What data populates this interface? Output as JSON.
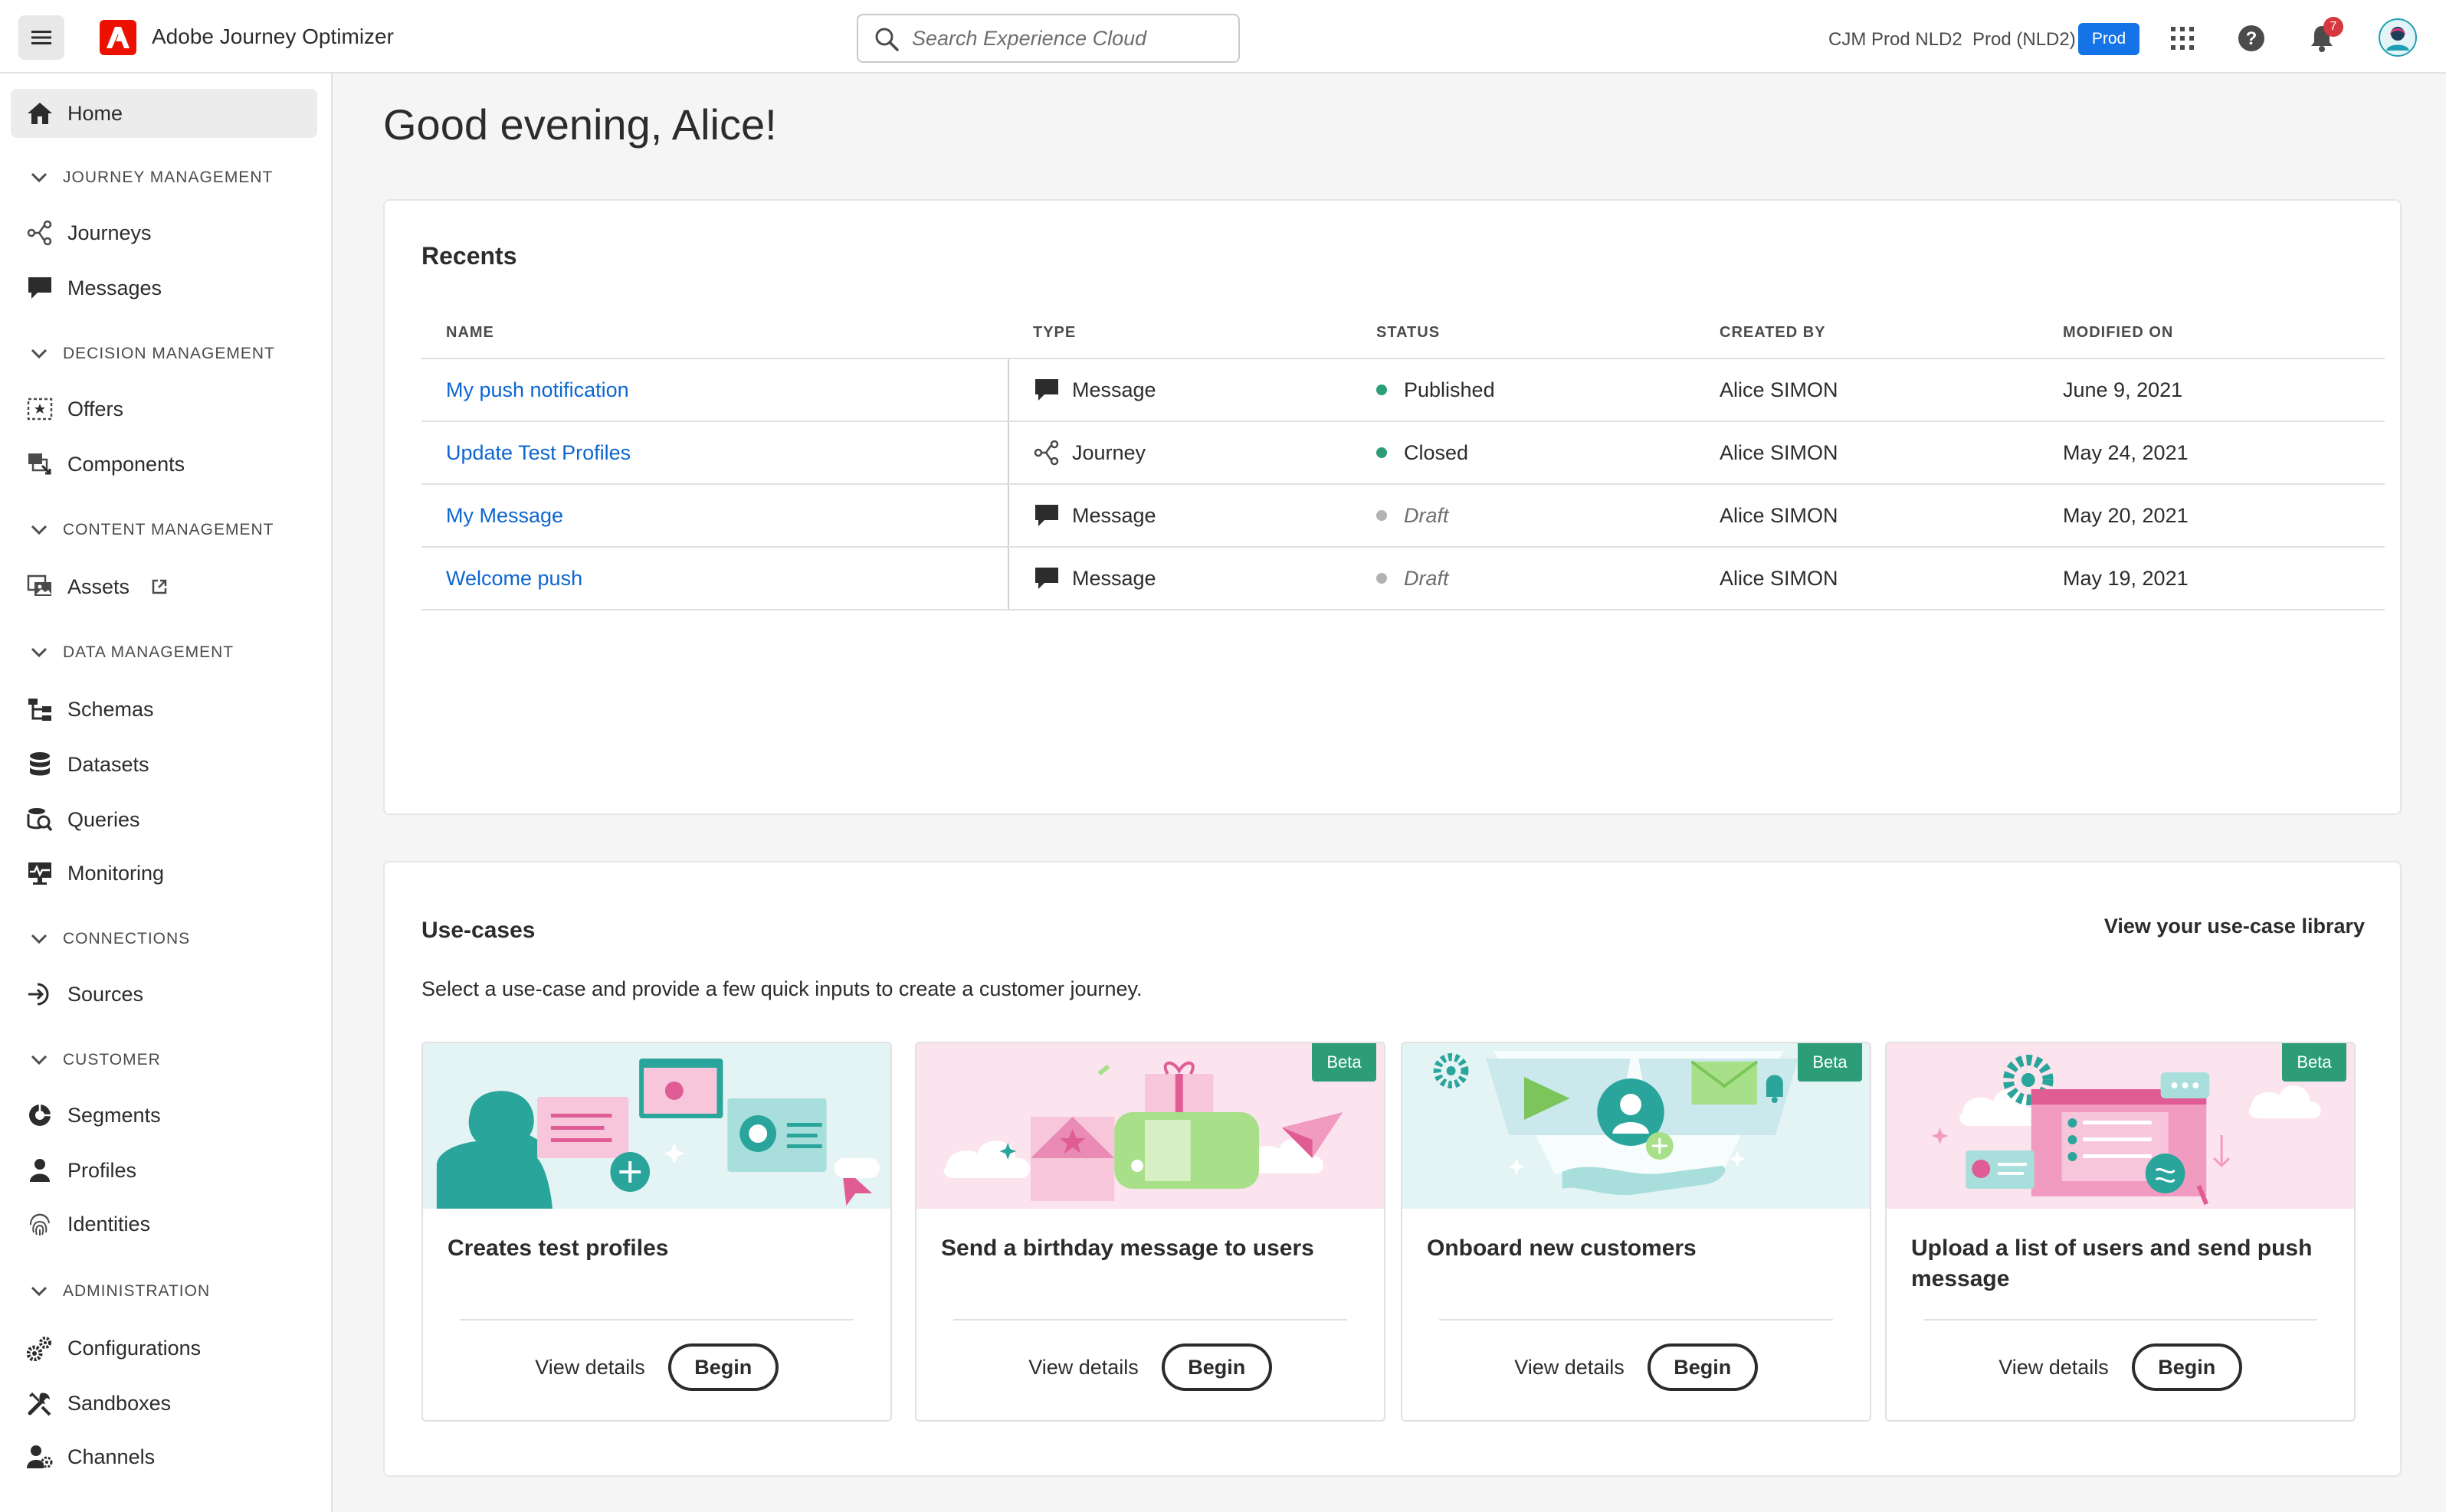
{
  "header": {
    "app_title": "Adobe Journey Optimizer",
    "search_placeholder": "Search Experience Cloud",
    "org_name": "CJM Prod NLD2",
    "sandbox_name": "Prod (NLD2)",
    "sandbox_badge": "Prod",
    "notification_count": "7"
  },
  "sidebar": {
    "home": "Home",
    "sections": [
      {
        "title": "JOURNEY MANAGEMENT",
        "items": [
          "Journeys",
          "Messages"
        ]
      },
      {
        "title": "DECISION MANAGEMENT",
        "items": [
          "Offers",
          "Components"
        ]
      },
      {
        "title": "CONTENT MANAGEMENT",
        "items": [
          "Assets"
        ]
      },
      {
        "title": "DATA MANAGEMENT",
        "items": [
          "Schemas",
          "Datasets",
          "Queries",
          "Monitoring"
        ]
      },
      {
        "title": "CONNECTIONS",
        "items": [
          "Sources"
        ]
      },
      {
        "title": "CUSTOMER",
        "items": [
          "Segments",
          "Profiles",
          "Identities"
        ]
      },
      {
        "title": "ADMINISTRATION",
        "items": [
          "Configurations",
          "Sandboxes",
          "Channels"
        ]
      }
    ]
  },
  "main": {
    "greeting": "Good evening, Alice!",
    "recents": {
      "title": "Recents",
      "columns": [
        "NAME",
        "TYPE",
        "STATUS",
        "CREATED BY",
        "MODIFIED ON"
      ],
      "rows": [
        {
          "name": "My push notification",
          "type": "Message",
          "status": "Published",
          "created_by": "Alice SIMON",
          "modified_on": "June 9, 2021"
        },
        {
          "name": "Update Test Profiles",
          "type": "Journey",
          "status": "Closed",
          "created_by": "Alice SIMON",
          "modified_on": "May 24, 2021"
        },
        {
          "name": "My Message",
          "type": "Message",
          "status": "Draft",
          "created_by": "Alice SIMON",
          "modified_on": "May 20, 2021"
        },
        {
          "name": "Welcome push",
          "type": "Message",
          "status": "Draft",
          "created_by": "Alice SIMON",
          "modified_on": "May 19, 2021"
        }
      ]
    },
    "usecases": {
      "title": "Use-cases",
      "library_link": "View your use-case library",
      "description": "Select a use-case and provide a few quick inputs to create a customer journey.",
      "view_details": "View details",
      "begin": "Begin",
      "beta": "Beta",
      "cards": [
        {
          "title": "Creates test profiles"
        },
        {
          "title": "Send a birthday message to users"
        },
        {
          "title": "Onboard new customers"
        },
        {
          "title": "Upload a list of users and send push message"
        }
      ]
    }
  },
  "colors": {
    "accent_blue": "#1473e6",
    "link_blue": "#0d66d0",
    "status_green": "#2d9d78",
    "status_gray": "#b3b3b3",
    "adobe_red": "#eb1000"
  }
}
